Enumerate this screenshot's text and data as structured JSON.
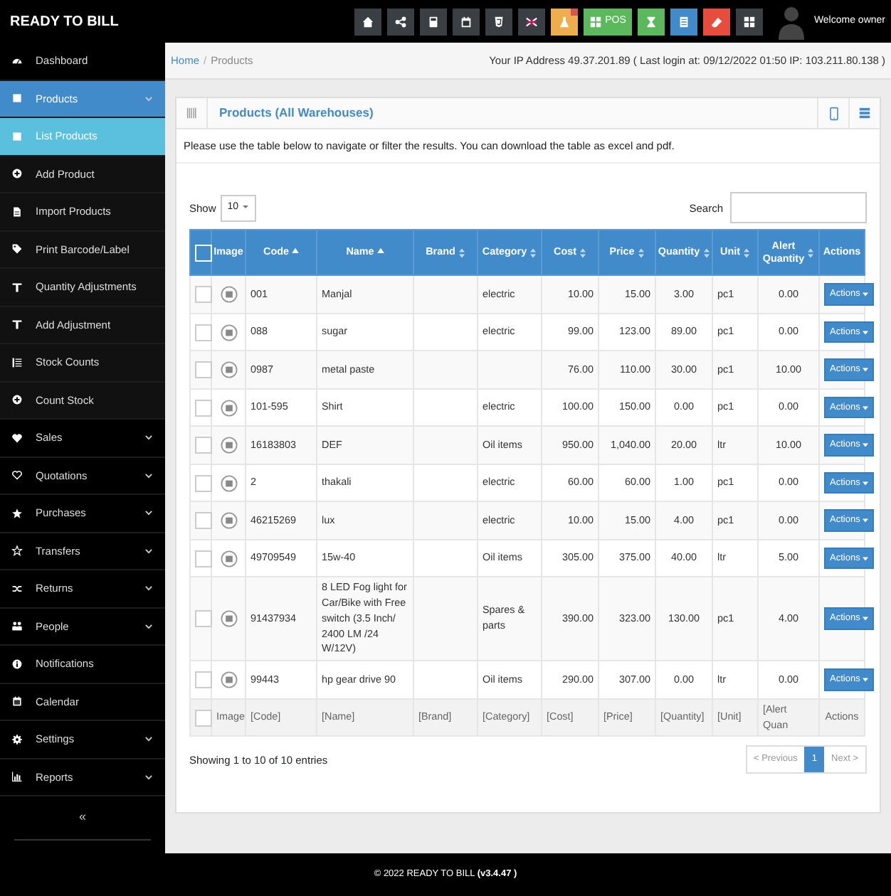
{
  "brand": "READY TO BILL",
  "toolbar": [
    {
      "color": "#3a3f44"
    },
    {
      "color": "#3a3f44"
    },
    {
      "color": "#3a3f44"
    },
    {
      "color": "#3a3f44"
    },
    {
      "color": "#3a3f44"
    },
    {
      "color": "#3a3f44"
    },
    {
      "color": "#f0ad4e",
      "badge": true
    },
    {
      "label": "POS",
      "color": "#5cb85c"
    },
    {
      "color": "#5cb85c"
    },
    {
      "color": "#428bca"
    },
    {
      "color": "#e74c3c"
    },
    {
      "color": "#3a3f44"
    }
  ],
  "user": "Welcome owner",
  "sidebar": {
    "items": [
      {
        "label": "Dashboard",
        "selected": false,
        "submenu": false
      },
      {
        "label": "Products",
        "selected": true,
        "submenu": true,
        "children": [
          {
            "label": "List Products",
            "selected": true
          },
          {
            "label": "Add Product",
            "selected": false
          },
          {
            "label": "Import Products",
            "selected": false
          },
          {
            "label": "Print Barcode/Label",
            "selected": false
          },
          {
            "label": "Quantity Adjustments",
            "selected": false
          },
          {
            "label": "Add Adjustment",
            "selected": false
          },
          {
            "label": "Stock Counts",
            "selected": false
          },
          {
            "label": "Count Stock",
            "selected": false
          }
        ]
      },
      {
        "label": "Sales",
        "selected": false,
        "submenu": true
      },
      {
        "label": "Quotations",
        "selected": false,
        "submenu": true
      },
      {
        "label": "Purchases",
        "selected": false,
        "submenu": true
      },
      {
        "label": "Transfers",
        "selected": false,
        "submenu": true
      },
      {
        "label": "Returns",
        "selected": false,
        "submenu": true
      },
      {
        "label": "People",
        "selected": false,
        "submenu": true
      },
      {
        "label": "Notifications",
        "selected": false,
        "submenu": false
      },
      {
        "label": "Calendar",
        "selected": false,
        "submenu": false
      },
      {
        "label": "Settings",
        "selected": false,
        "submenu": true
      },
      {
        "label": "Reports",
        "selected": false,
        "submenu": true
      }
    ],
    "collapse": "«"
  },
  "breadcrumb": [
    {
      "label": "Home",
      "link": true
    },
    {
      "label": "Products",
      "link": false
    }
  ],
  "breadcrumb_separator": "/",
  "ip_info": "Your IP Address 49.37.201.89 ( Last login at: 09/12/2022 01:50 IP: 103.211.80.138 )",
  "panel": {
    "title": "Products (All Warehouses)",
    "description": "Please use the table below to navigate or filter the results. You can download the table as excel and pdf."
  },
  "table": {
    "show_label": "Show",
    "page_size": "10",
    "search_label": "Search",
    "select_all_checked": false,
    "columns": [
      {
        "label": "Image",
        "sortable": false
      },
      {
        "label": "Code",
        "sortable": true,
        "sorted": true
      },
      {
        "label": "Name",
        "sortable": true,
        "sorted": true
      },
      {
        "label": "Brand",
        "sortable": true,
        "sorted": false
      },
      {
        "label": "Category",
        "sortable": true,
        "sorted": false
      },
      {
        "label": "Cost",
        "sortable": true,
        "sorted": false
      },
      {
        "label": "Price",
        "sortable": true,
        "sorted": false
      },
      {
        "label": "Quantity",
        "sortable": true,
        "sorted": false
      },
      {
        "label": "Unit",
        "sortable": true,
        "sorted": false
      },
      {
        "label": "Alert Quantity",
        "sortable": true,
        "sorted": false
      },
      {
        "label": "Actions",
        "sortable": false
      }
    ],
    "rows": [
      {
        "checked": false,
        "cells": [
          "",
          "001",
          "Manjal",
          "",
          "electric",
          "10.00",
          "15.00",
          "3.00",
          "pc1",
          "0.00",
          "Actions"
        ]
      },
      {
        "checked": false,
        "cells": [
          "",
          "088",
          "sugar",
          "",
          "electric",
          "99.00",
          "123.00",
          "89.00",
          "pc1",
          "0.00",
          "Actions"
        ]
      },
      {
        "checked": false,
        "cells": [
          "",
          "0987",
          "metal paste",
          "",
          "",
          "76.00",
          "110.00",
          "30.00",
          "pc1",
          "10.00",
          "Actions"
        ]
      },
      {
        "checked": false,
        "cells": [
          "",
          "101-595",
          "Shirt",
          "",
          "electric",
          "100.00",
          "150.00",
          "0.00",
          "pc1",
          "0.00",
          "Actions"
        ]
      },
      {
        "checked": false,
        "cells": [
          "",
          "16183803",
          "DEF",
          "",
          "Oil items",
          "950.00",
          "1,040.00",
          "20.00",
          "ltr",
          "10.00",
          "Actions"
        ]
      },
      {
        "checked": false,
        "cells": [
          "",
          "2",
          "thakali",
          "",
          "electric",
          "60.00",
          "60.00",
          "1.00",
          "pc1",
          "0.00",
          "Actions"
        ]
      },
      {
        "checked": false,
        "cells": [
          "",
          "46215269",
          "lux",
          "",
          "electric",
          "10.00",
          "15.00",
          "4.00",
          "pc1",
          "0.00",
          "Actions"
        ]
      },
      {
        "checked": false,
        "cells": [
          "",
          "49709549",
          "15w-40",
          "",
          "Oil items",
          "305.00",
          "375.00",
          "40.00",
          "ltr",
          "5.00",
          "Actions"
        ]
      },
      {
        "checked": false,
        "cells": [
          "",
          "91437934",
          "8 LED Fog light for Car/Bike with Free switch (3.5 Inch/ 2400 LM /24 W/12V)",
          "",
          "Spares & parts",
          "390.00",
          "323.00",
          "130.00",
          "pc1",
          "4.00",
          "Actions"
        ]
      },
      {
        "checked": false,
        "cells": [
          "",
          "99443",
          "hp gear drive 90",
          "",
          "Oil items",
          "290.00",
          "307.00",
          "0.00",
          "ltr",
          "0.00",
          "Actions"
        ]
      }
    ],
    "footer_checked": false,
    "footer": [
      "Image",
      "[Code]",
      "[Name]",
      "[Brand]",
      "[Category]",
      "[Cost]",
      "[Price]",
      "[Quantity]",
      "[Unit]",
      "[Alert Quan",
      "Actions"
    ],
    "info": "Showing 1 to 10 of 10 entries",
    "pagination": [
      {
        "label": "< Previous",
        "selected": false,
        "disabled": true
      },
      {
        "label": "1",
        "selected": true,
        "disabled": false
      },
      {
        "label": "Next >",
        "selected": false,
        "disabled": true
      }
    ]
  },
  "footer": "© 2022 READY TO BILL **(v3.4.47 )**"
}
